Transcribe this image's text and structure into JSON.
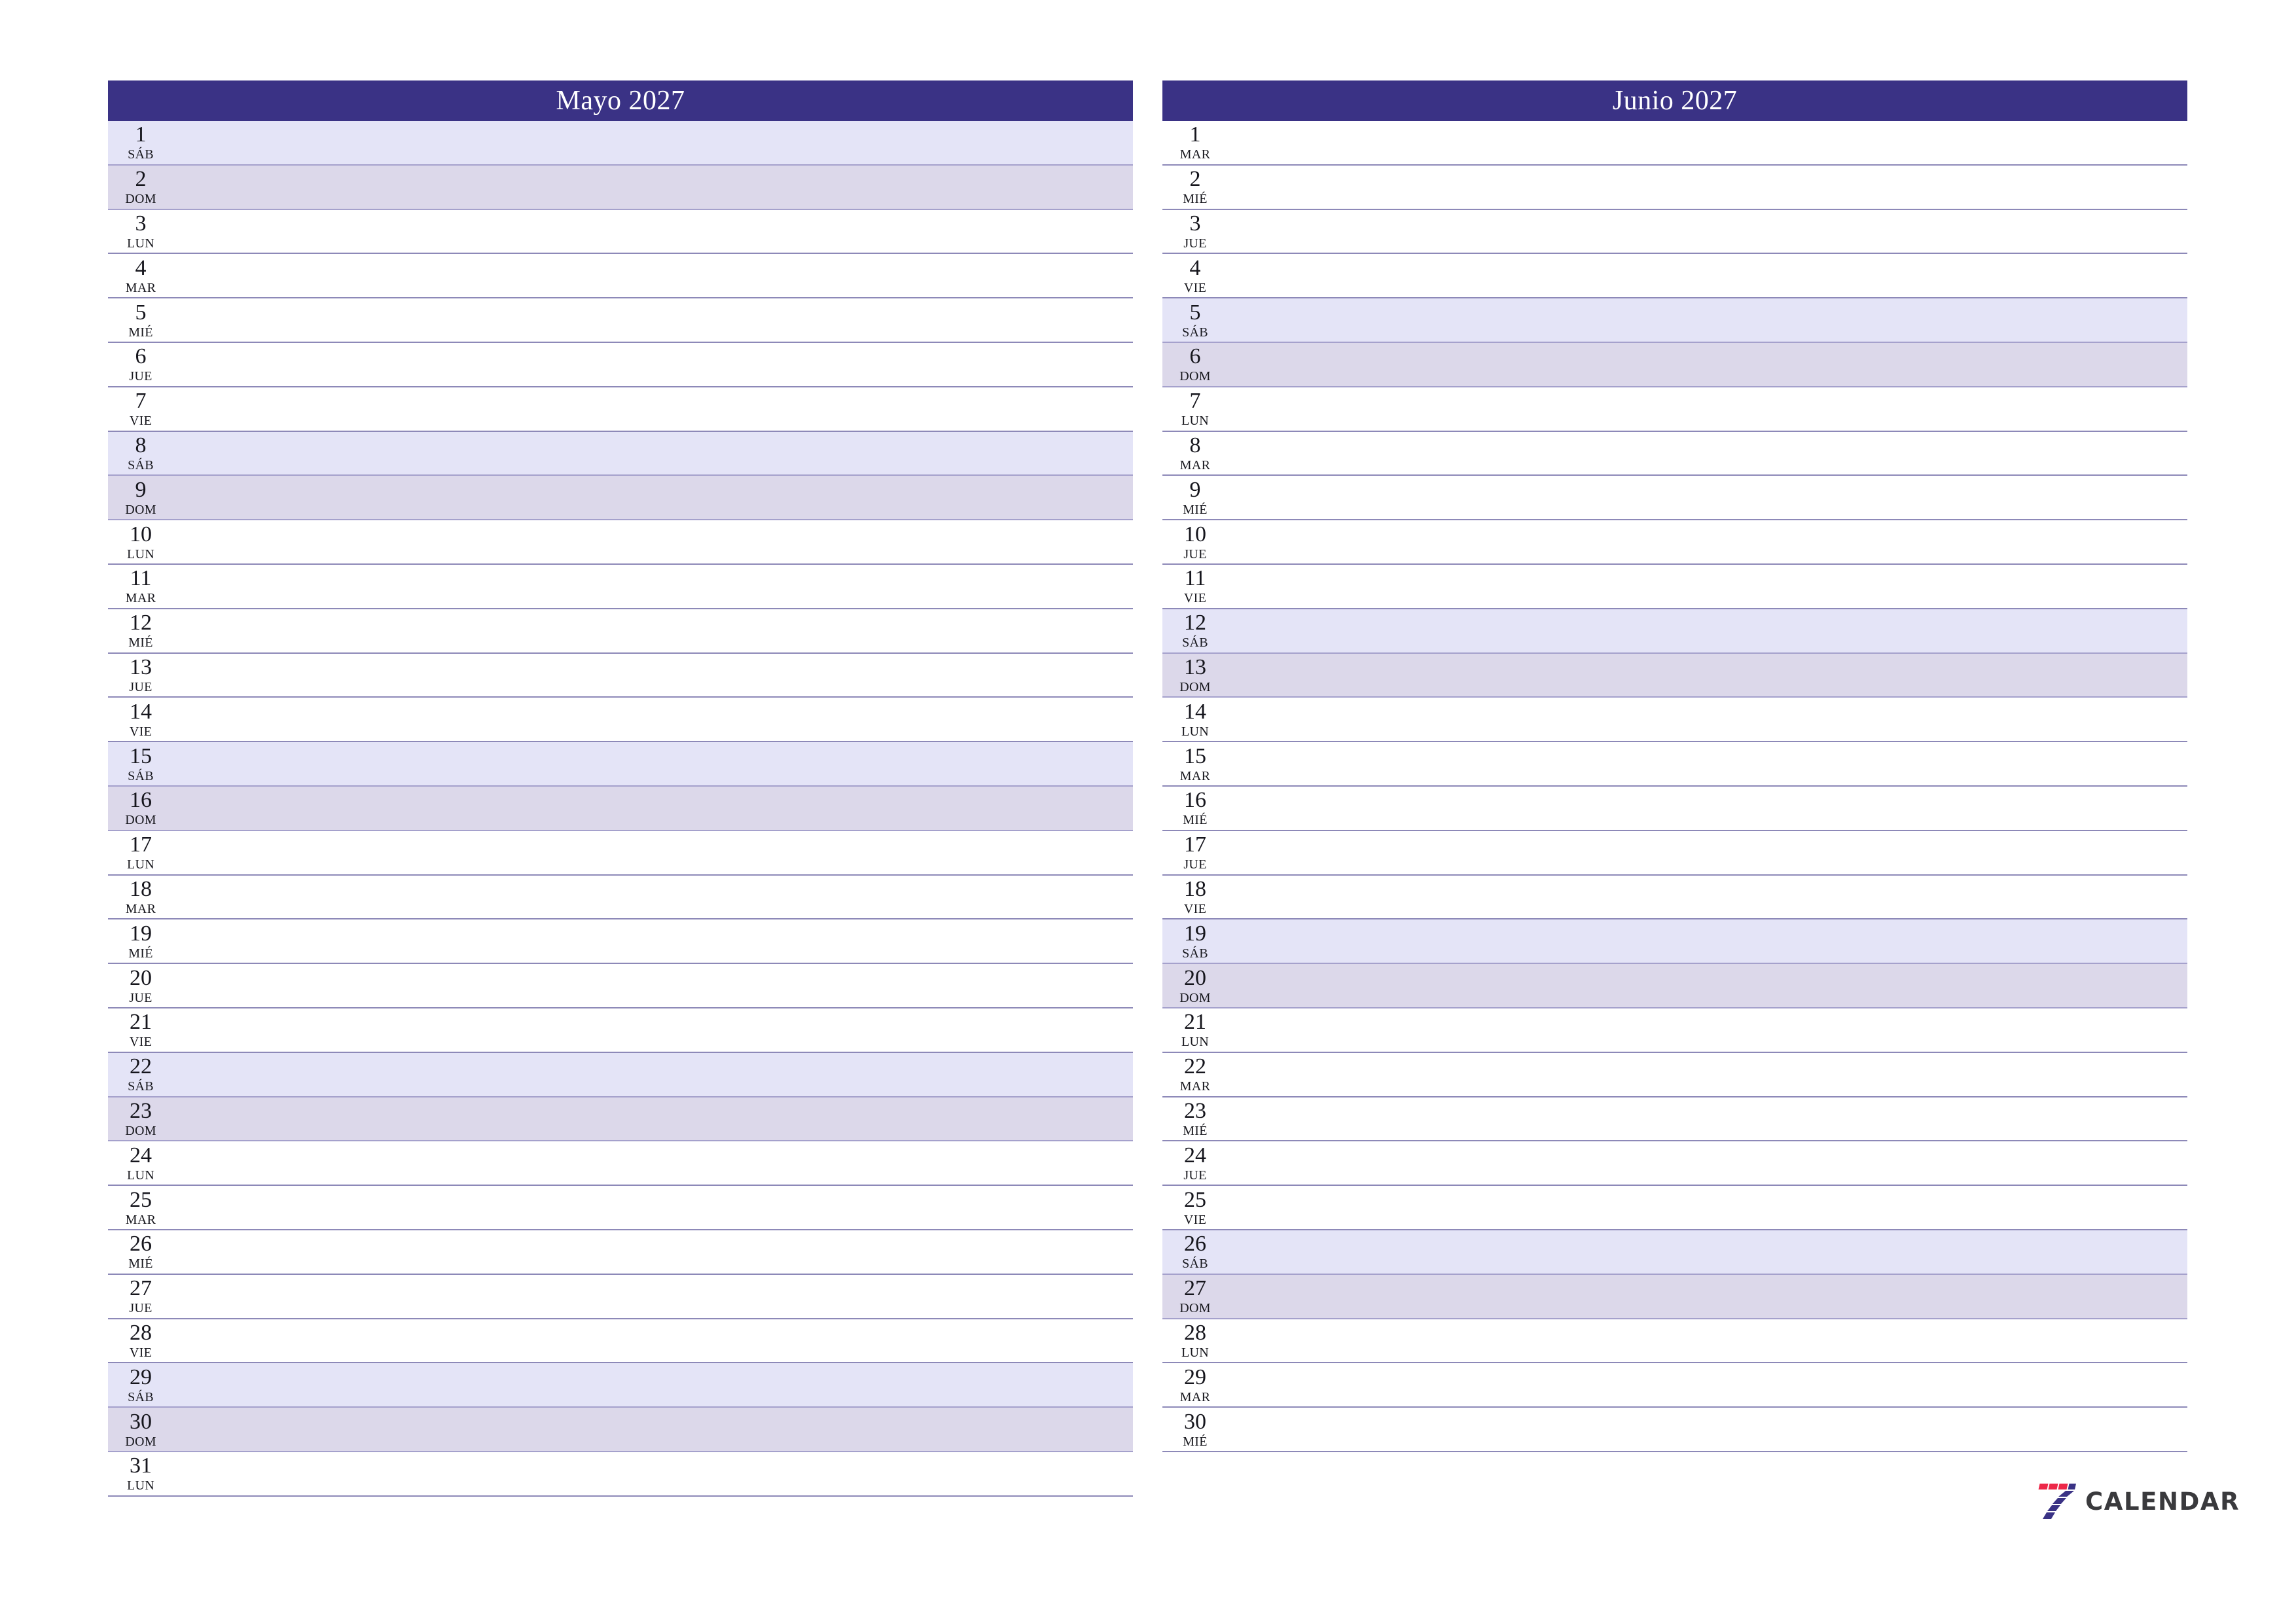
{
  "document": {
    "type": "printable-monthly-planner",
    "language": "es",
    "page_background": "#ffffff"
  },
  "colors": {
    "header_bar": "#3a3285",
    "header_text": "#ffffff",
    "saturday_row": "#e4e4f7",
    "sunday_row": "#dcd8ea",
    "row_divider": "#8d89b8",
    "weekend_divider": "#a5a1cc",
    "day_text": "#15151c",
    "logo_red": "#ed2748",
    "logo_blue": "#3a3285",
    "logo_word": "#3a3a3d"
  },
  "months": [
    {
      "id": "mayo-2027",
      "title": "Mayo 2027",
      "days": [
        {
          "num": "1",
          "dow": "SÁB",
          "kind": "sat"
        },
        {
          "num": "2",
          "dow": "DOM",
          "kind": "sun"
        },
        {
          "num": "3",
          "dow": "LUN",
          "kind": "weekday"
        },
        {
          "num": "4",
          "dow": "MAR",
          "kind": "weekday"
        },
        {
          "num": "5",
          "dow": "MIÉ",
          "kind": "weekday"
        },
        {
          "num": "6",
          "dow": "JUE",
          "kind": "weekday"
        },
        {
          "num": "7",
          "dow": "VIE",
          "kind": "weekday"
        },
        {
          "num": "8",
          "dow": "SÁB",
          "kind": "sat"
        },
        {
          "num": "9",
          "dow": "DOM",
          "kind": "sun"
        },
        {
          "num": "10",
          "dow": "LUN",
          "kind": "weekday"
        },
        {
          "num": "11",
          "dow": "MAR",
          "kind": "weekday"
        },
        {
          "num": "12",
          "dow": "MIÉ",
          "kind": "weekday"
        },
        {
          "num": "13",
          "dow": "JUE",
          "kind": "weekday"
        },
        {
          "num": "14",
          "dow": "VIE",
          "kind": "weekday"
        },
        {
          "num": "15",
          "dow": "SÁB",
          "kind": "sat"
        },
        {
          "num": "16",
          "dow": "DOM",
          "kind": "sun"
        },
        {
          "num": "17",
          "dow": "LUN",
          "kind": "weekday"
        },
        {
          "num": "18",
          "dow": "MAR",
          "kind": "weekday"
        },
        {
          "num": "19",
          "dow": "MIÉ",
          "kind": "weekday"
        },
        {
          "num": "20",
          "dow": "JUE",
          "kind": "weekday"
        },
        {
          "num": "21",
          "dow": "VIE",
          "kind": "weekday"
        },
        {
          "num": "22",
          "dow": "SÁB",
          "kind": "sat"
        },
        {
          "num": "23",
          "dow": "DOM",
          "kind": "sun"
        },
        {
          "num": "24",
          "dow": "LUN",
          "kind": "weekday"
        },
        {
          "num": "25",
          "dow": "MAR",
          "kind": "weekday"
        },
        {
          "num": "26",
          "dow": "MIÉ",
          "kind": "weekday"
        },
        {
          "num": "27",
          "dow": "JUE",
          "kind": "weekday"
        },
        {
          "num": "28",
          "dow": "VIE",
          "kind": "weekday"
        },
        {
          "num": "29",
          "dow": "SÁB",
          "kind": "sat"
        },
        {
          "num": "30",
          "dow": "DOM",
          "kind": "sun"
        },
        {
          "num": "31",
          "dow": "LUN",
          "kind": "weekday"
        }
      ]
    },
    {
      "id": "junio-2027",
      "title": "Junio 2027",
      "days": [
        {
          "num": "1",
          "dow": "MAR",
          "kind": "weekday"
        },
        {
          "num": "2",
          "dow": "MIÉ",
          "kind": "weekday"
        },
        {
          "num": "3",
          "dow": "JUE",
          "kind": "weekday"
        },
        {
          "num": "4",
          "dow": "VIE",
          "kind": "weekday"
        },
        {
          "num": "5",
          "dow": "SÁB",
          "kind": "sat"
        },
        {
          "num": "6",
          "dow": "DOM",
          "kind": "sun"
        },
        {
          "num": "7",
          "dow": "LUN",
          "kind": "weekday"
        },
        {
          "num": "8",
          "dow": "MAR",
          "kind": "weekday"
        },
        {
          "num": "9",
          "dow": "MIÉ",
          "kind": "weekday"
        },
        {
          "num": "10",
          "dow": "JUE",
          "kind": "weekday"
        },
        {
          "num": "11",
          "dow": "VIE",
          "kind": "weekday"
        },
        {
          "num": "12",
          "dow": "SÁB",
          "kind": "sat"
        },
        {
          "num": "13",
          "dow": "DOM",
          "kind": "sun"
        },
        {
          "num": "14",
          "dow": "LUN",
          "kind": "weekday"
        },
        {
          "num": "15",
          "dow": "MAR",
          "kind": "weekday"
        },
        {
          "num": "16",
          "dow": "MIÉ",
          "kind": "weekday"
        },
        {
          "num": "17",
          "dow": "JUE",
          "kind": "weekday"
        },
        {
          "num": "18",
          "dow": "VIE",
          "kind": "weekday"
        },
        {
          "num": "19",
          "dow": "SÁB",
          "kind": "sat"
        },
        {
          "num": "20",
          "dow": "DOM",
          "kind": "sun"
        },
        {
          "num": "21",
          "dow": "LUN",
          "kind": "weekday"
        },
        {
          "num": "22",
          "dow": "MAR",
          "kind": "weekday"
        },
        {
          "num": "23",
          "dow": "MIÉ",
          "kind": "weekday"
        },
        {
          "num": "24",
          "dow": "JUE",
          "kind": "weekday"
        },
        {
          "num": "25",
          "dow": "VIE",
          "kind": "weekday"
        },
        {
          "num": "26",
          "dow": "SÁB",
          "kind": "sat"
        },
        {
          "num": "27",
          "dow": "DOM",
          "kind": "sun"
        },
        {
          "num": "28",
          "dow": "LUN",
          "kind": "weekday"
        },
        {
          "num": "29",
          "dow": "MAR",
          "kind": "weekday"
        },
        {
          "num": "30",
          "dow": "MIÉ",
          "kind": "weekday"
        }
      ]
    }
  ],
  "brand": {
    "icon": "seven-logo-icon",
    "word": "CALENDAR"
  }
}
